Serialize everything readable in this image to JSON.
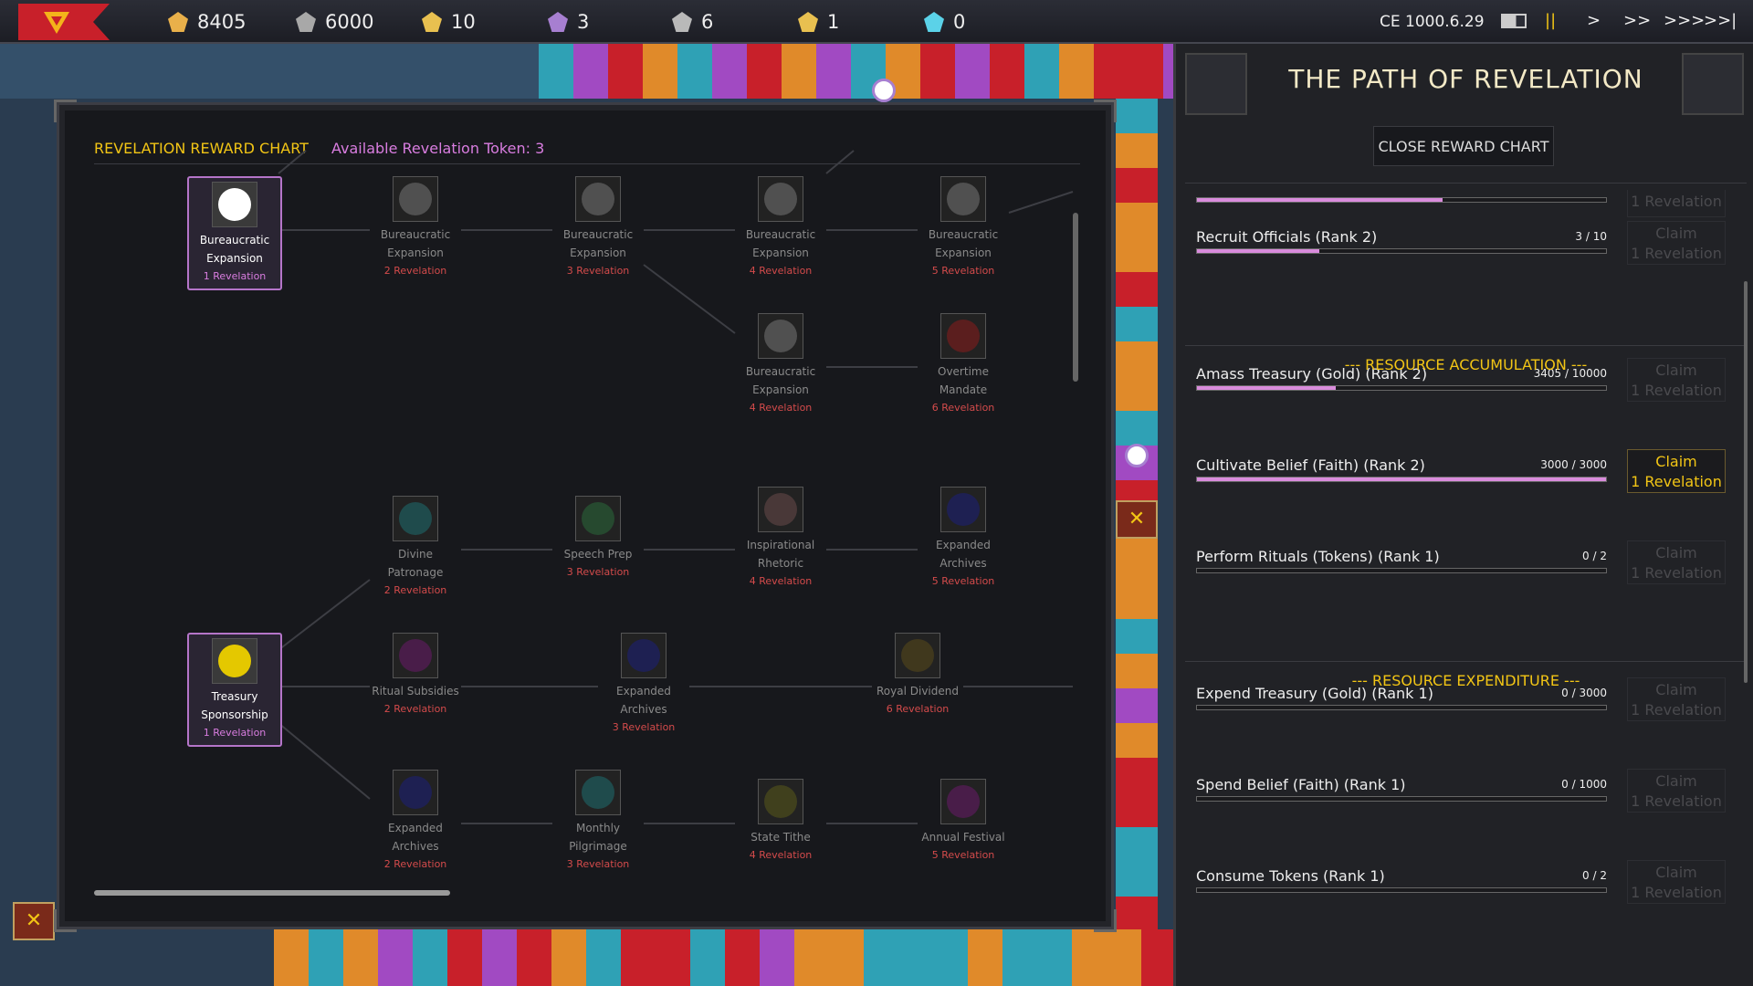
{
  "topbar": {
    "resources": [
      {
        "icon": "gold-pile-icon",
        "value": "8405",
        "color": "#e9b04a"
      },
      {
        "icon": "belief-icon",
        "value": "6000",
        "color": "#a8a8a8"
      },
      {
        "icon": "shield-token-icon",
        "value": "10",
        "color": "#e8c050"
      },
      {
        "icon": "faith-token-icon",
        "value": "3",
        "color": "#a77fd1"
      },
      {
        "icon": "wing-token-icon",
        "value": "6",
        "color": "#b9b9b9"
      },
      {
        "icon": "golden-wing-icon",
        "value": "1",
        "color": "#e8c050"
      },
      {
        "icon": "diamond-wing-icon",
        "value": "0",
        "color": "#5bd2e8"
      }
    ],
    "date": "CE 1000.6.29",
    "controls": [
      "||",
      ">",
      ">>",
      ">>>",
      ">>|"
    ]
  },
  "chart": {
    "title": "REVELATION REWARD CHART",
    "tokens": "Available Revelation Token: 3",
    "nodes": [
      {
        "name": "Bureaucratic Expansion",
        "cost": "1 Revelation",
        "state": "active",
        "color": "#ffffff"
      },
      {
        "name": "Bureaucratic Expansion",
        "cost": "2 Revelation",
        "state": "locked",
        "color": "#777777"
      },
      {
        "name": "Bureaucratic Expansion",
        "cost": "3 Revelation",
        "state": "locked",
        "color": "#777777"
      },
      {
        "name": "Bureaucratic Expansion",
        "cost": "4 Revelation",
        "state": "locked",
        "color": "#777777"
      },
      {
        "name": "Bureaucratic Expansion",
        "cost": "5 Revelation",
        "state": "locked",
        "color": "#777777"
      },
      {
        "name": "Bureaucratic Expansion",
        "cost": "4 Revelation",
        "state": "locked",
        "color": "#777777"
      },
      {
        "name": "Overtime Mandate",
        "cost": "6 Revelation",
        "state": "locked",
        "color": "#8a1b1b"
      },
      {
        "name": "Divine Patronage",
        "cost": "2 Revelation",
        "state": "locked",
        "color": "#1d6e70"
      },
      {
        "name": "Speech Prep",
        "cost": "3 Revelation",
        "state": "locked",
        "color": "#2a6a3a"
      },
      {
        "name": "Inspirational Rhetoric",
        "cost": "4 Revelation",
        "state": "locked",
        "color": "#6a4a4a"
      },
      {
        "name": "Expanded Archives",
        "cost": "5 Revelation",
        "state": "locked",
        "color": "#1b1f7a"
      },
      {
        "name": "Treasury Sponsorship",
        "cost": "1 Revelation",
        "state": "active",
        "color": "#e4c800"
      },
      {
        "name": "Ritual Subsidies",
        "cost": "2 Revelation",
        "state": "locked",
        "color": "#6a1a6a"
      },
      {
        "name": "Expanded Archives",
        "cost": "3 Revelation",
        "state": "locked",
        "color": "#1b1f7a"
      },
      {
        "name": "Royal Dividend",
        "cost": "6 Revelation",
        "state": "locked",
        "color": "#5a4a1a"
      },
      {
        "name": "Expanded Archives",
        "cost": "2 Revelation",
        "state": "locked",
        "color": "#1b1f7a"
      },
      {
        "name": "Monthly Pilgrimage",
        "cost": "3 Revelation",
        "state": "locked",
        "color": "#1d6e70"
      },
      {
        "name": "State Tithe",
        "cost": "4 Revelation",
        "state": "locked",
        "color": "#5a5a1a"
      },
      {
        "name": "Annual Festival",
        "cost": "5 Revelation",
        "state": "locked",
        "color": "#6a1a6a"
      }
    ]
  },
  "panel": {
    "title": "THE PATH OF REVELATION",
    "close": "CLOSE REWARD CHART",
    "partial_claim": "1 Revelation",
    "tasks": [
      {
        "name": "Recruit Officials (Rank 2)",
        "progress": "3 / 10",
        "fraction": 0.3,
        "claim": "Claim",
        "reward": "1 Revelation",
        "ready": false
      },
      {
        "name": "Amass Treasury (Gold) (Rank 2)",
        "progress": "3405 / 10000",
        "fraction": 0.34,
        "claim": "Claim",
        "reward": "1 Revelation",
        "ready": false
      },
      {
        "name": "Cultivate Belief (Faith) (Rank 2)",
        "progress": "3000 / 3000",
        "fraction": 1.0,
        "claim": "Claim",
        "reward": "1 Revelation",
        "ready": true
      },
      {
        "name": "Perform Rituals (Tokens) (Rank 1)",
        "progress": "0 / 2",
        "fraction": 0.0,
        "claim": "Claim",
        "reward": "1 Revelation",
        "ready": false
      },
      {
        "name": "Expend Treasury (Gold) (Rank 1)",
        "progress": "0 / 3000",
        "fraction": 0.0,
        "claim": "Claim",
        "reward": "1 Revelation",
        "ready": false
      },
      {
        "name": "Spend Belief (Faith) (Rank 1)",
        "progress": "0 / 1000",
        "fraction": 0.0,
        "claim": "Claim",
        "reward": "1 Revelation",
        "ready": false
      },
      {
        "name": "Consume Tokens (Rank 1)",
        "progress": "0 / 2",
        "fraction": 0.0,
        "claim": "Claim",
        "reward": "1 Revelation",
        "ready": false
      }
    ],
    "sections": [
      "--- RESOURCE ACCUMULATION ---",
      "--- RESOURCE EXPENDITURE ---"
    ]
  }
}
